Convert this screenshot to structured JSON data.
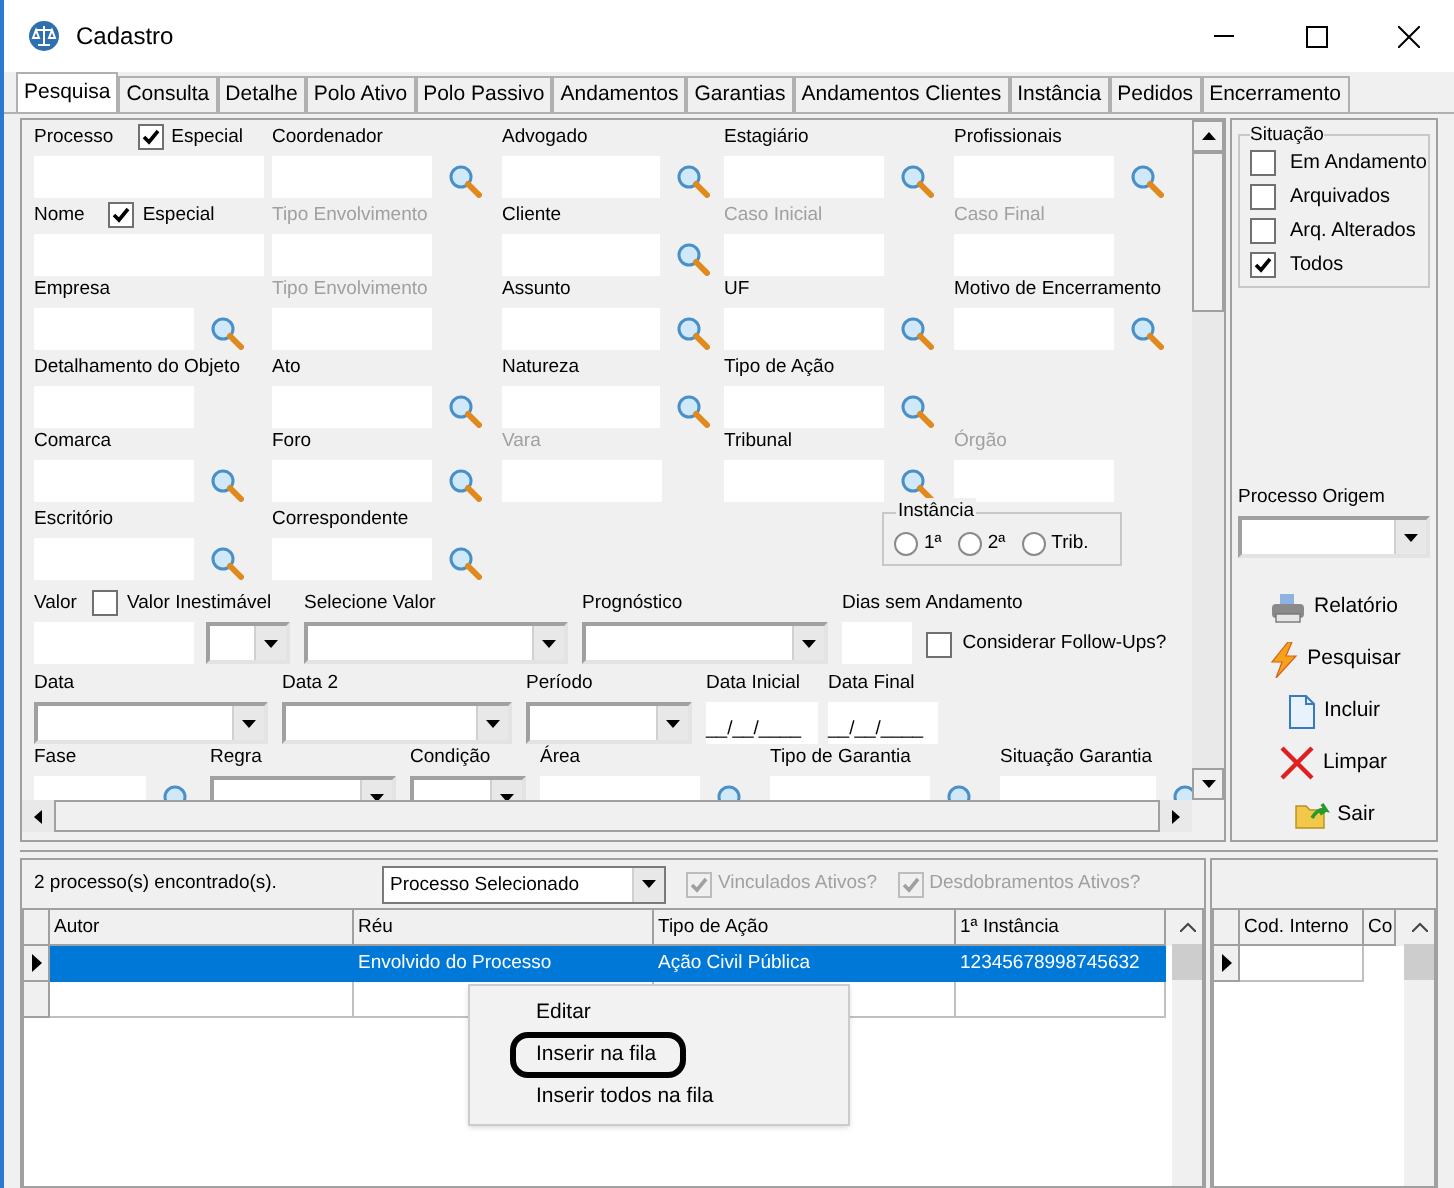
{
  "window": {
    "title": "Cadastro"
  },
  "tabs": [
    {
      "label": "Pesquisa",
      "selected": true
    },
    {
      "label": "Consulta",
      "selected": false
    },
    {
      "label": "Detalhe",
      "selected": false
    },
    {
      "label": "Polo Ativo",
      "selected": false
    },
    {
      "label": "Polo Passivo",
      "selected": false
    },
    {
      "label": "Andamentos",
      "selected": false
    },
    {
      "label": "Garantias",
      "selected": false
    },
    {
      "label": "Andamentos Clientes",
      "selected": false
    },
    {
      "label": "Instância",
      "selected": false
    },
    {
      "label": "Pedidos",
      "selected": false
    },
    {
      "label": "Encerramento",
      "selected": false
    }
  ],
  "search_form": {
    "rows": [
      {
        "fields": [
          {
            "kind": "text",
            "label": "Processo",
            "option": {
              "label": "Especial",
              "checked": true
            }
          },
          {
            "kind": "lookup",
            "label": "Coordenador"
          },
          {
            "kind": "lookup",
            "label": "Advogado"
          },
          {
            "kind": "lookup",
            "label": "Estagiário"
          },
          {
            "kind": "lookup",
            "label": "Profissionais"
          }
        ]
      },
      {
        "fields": [
          {
            "kind": "text",
            "label": "Nome",
            "option": {
              "label": "Especial",
              "checked": true
            }
          },
          {
            "kind": "text",
            "label": "Tipo Envolvimento",
            "disabled": true
          },
          {
            "kind": "lookup",
            "label": "Cliente"
          },
          {
            "kind": "text",
            "label": "Caso Inicial",
            "disabled": true
          },
          {
            "kind": "text",
            "label": "Caso Final",
            "disabled": true
          }
        ]
      },
      {
        "fields": [
          {
            "kind": "lookup",
            "label": "Empresa"
          },
          {
            "kind": "text",
            "label": "Tipo Envolvimento",
            "disabled": true
          },
          {
            "kind": "lookup",
            "label": "Assunto"
          },
          {
            "kind": "lookup",
            "label": "UF"
          },
          {
            "kind": "lookup",
            "label": "Motivo de Encerramento"
          }
        ]
      },
      {
        "fields": [
          {
            "kind": "text",
            "label": "Detalhamento do Objeto"
          },
          {
            "kind": "lookup",
            "label": "Ato"
          },
          {
            "kind": "lookup",
            "label": "Natureza"
          },
          {
            "kind": "lookup",
            "label": "Tipo de Ação"
          }
        ]
      },
      {
        "fields": [
          {
            "kind": "lookup",
            "label": "Comarca"
          },
          {
            "kind": "lookup",
            "label": "Foro"
          },
          {
            "kind": "text",
            "label": "Vara",
            "disabled": true
          },
          {
            "kind": "lookup",
            "label": "Tribunal"
          },
          {
            "kind": "text",
            "label": "Órgão",
            "disabled": true
          }
        ]
      },
      {
        "fields": [
          {
            "kind": "lookup",
            "label": "Escritório"
          },
          {
            "kind": "lookup",
            "label": "Correspondente"
          },
          {
            "kind": "radio_group",
            "label": "Instância",
            "options": [
              {
                "label": "1ª",
                "selected": false
              },
              {
                "label": "2ª",
                "selected": false
              },
              {
                "label": "Trib.",
                "selected": false
              }
            ]
          }
        ]
      },
      {
        "fields": [
          {
            "kind": "text",
            "label": "Valor",
            "option": {
              "label": "Valor Inestimável",
              "checked": false
            }
          },
          {
            "kind": "combo"
          },
          {
            "kind": "combo",
            "label": "Selecione Valor"
          },
          {
            "kind": "combo",
            "label": "Prognóstico"
          },
          {
            "kind": "text",
            "label": "Dias sem Andamento"
          },
          {
            "kind": "checkbox",
            "label": "Considerar Follow-Ups?",
            "checked": false
          }
        ]
      },
      {
        "fields": [
          {
            "kind": "combo",
            "label": "Data"
          },
          {
            "kind": "combo",
            "label": "Data 2"
          },
          {
            "kind": "combo",
            "label": "Período"
          },
          {
            "kind": "date",
            "label": "Data Inicial",
            "value": "__/__/____"
          },
          {
            "kind": "date",
            "label": "Data Final",
            "value": "__/__/____"
          }
        ]
      },
      {
        "fields": [
          {
            "kind": "lookup",
            "label": "Fase"
          },
          {
            "kind": "combo",
            "label": "Regra"
          },
          {
            "kind": "combo",
            "label": "Condição"
          },
          {
            "kind": "lookup",
            "label": "Área"
          },
          {
            "kind": "lookup",
            "label": "Tipo de Garantia"
          },
          {
            "kind": "lookup",
            "label": "Situação Garantia"
          }
        ]
      }
    ]
  },
  "situacao": {
    "title": "Situação",
    "options": [
      {
        "label": "Em Andamento",
        "checked": false
      },
      {
        "label": "Arquivados",
        "checked": false
      },
      {
        "label": "Arq. Alterados",
        "checked": false
      },
      {
        "label": "Todos",
        "checked": true
      }
    ]
  },
  "processo_origem": {
    "label": "Processo Origem"
  },
  "actions": [
    {
      "label": "Relatório",
      "kind": "report"
    },
    {
      "label": "Pesquisar",
      "kind": "search"
    },
    {
      "label": "Incluir",
      "kind": "new"
    },
    {
      "label": "Limpar",
      "kind": "clear"
    },
    {
      "label": "Sair",
      "kind": "exit"
    }
  ],
  "results": {
    "count_text": "2 processo(s) encontrado(s).",
    "mode": "Processo Selecionado",
    "toggles": [
      {
        "label": "Vinculados Ativos?",
        "checked": true,
        "disabled": true
      },
      {
        "label": "Desdobramentos Ativos?",
        "checked": true,
        "disabled": true
      }
    ],
    "columns": [
      "Autor",
      "Réu",
      "Tipo de Ação",
      "1ª Instância"
    ],
    "rows": [
      {
        "selected": true,
        "cells": [
          null,
          "Envolvido do Processo",
          "Ação Civil Pública",
          "12345678998745632"
        ]
      },
      {
        "selected": false,
        "cells": [
          null,
          null,
          null,
          null
        ]
      }
    ]
  },
  "context_menu": {
    "items": [
      {
        "label": "Editar",
        "circled": false
      },
      {
        "label": "Inserir na fila",
        "circled": true
      },
      {
        "label": "Inserir todos na fila",
        "circled": false
      }
    ]
  },
  "side_grid": {
    "columns": [
      "Cod. Interno",
      "Co"
    ]
  }
}
